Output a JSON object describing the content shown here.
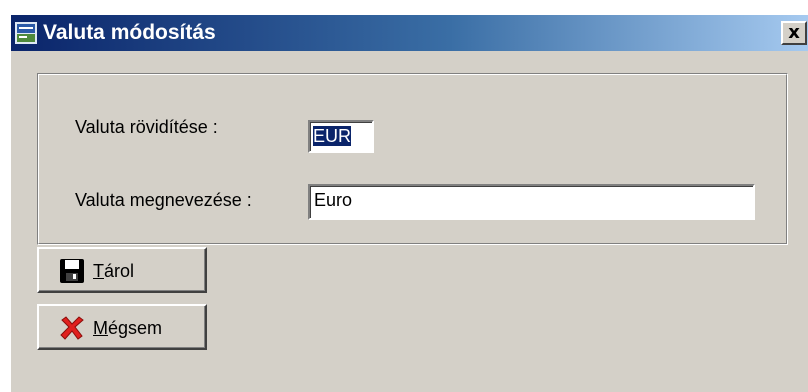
{
  "window": {
    "title": "Valuta módosítás",
    "close_label": "x"
  },
  "form": {
    "abbr_label": "Valuta rövidítése :",
    "abbr_value": "EUR",
    "name_label": "Valuta megnevezése :",
    "name_value": "Euro"
  },
  "buttons": {
    "save": {
      "mnemonic": "T",
      "rest": "árol",
      "icon": "floppy-disk-icon"
    },
    "cancel": {
      "mnemonic": "M",
      "rest": "égsem",
      "icon": "red-x-icon"
    }
  },
  "colors": {
    "titlebar_start": "#0a246a",
    "titlebar_end": "#a6caf0",
    "window_face": "#d4d0c8",
    "selection": "#0a246a",
    "cancel_icon": "#e0201e"
  }
}
